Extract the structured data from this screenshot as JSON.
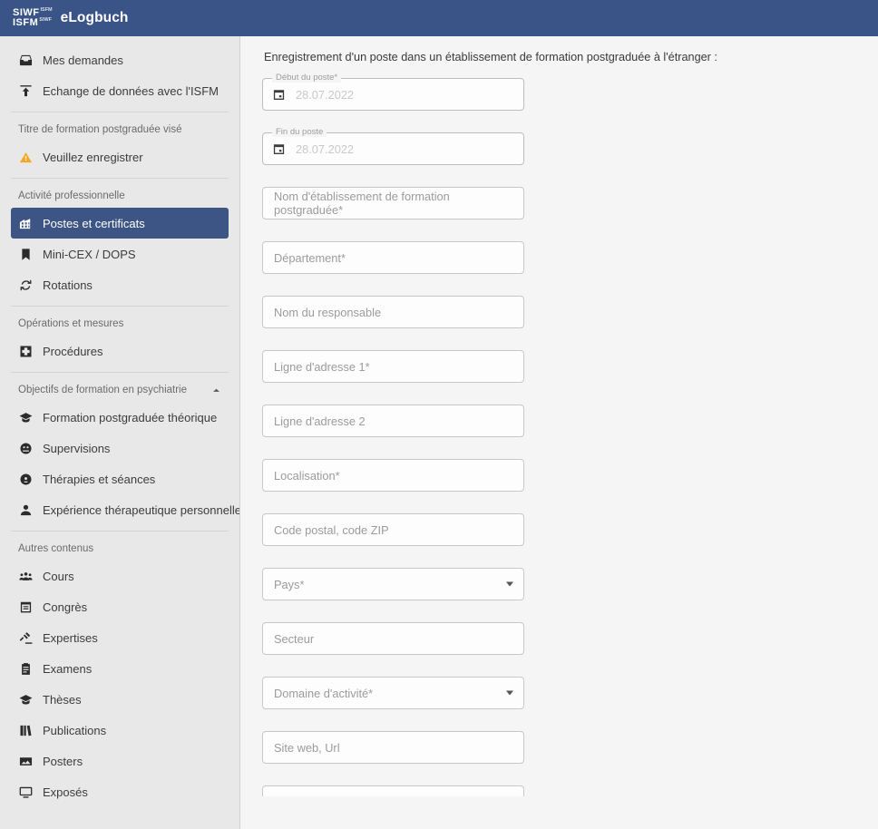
{
  "header": {
    "logo_line1": "SIWF",
    "logo_line1_sup": "ISFM",
    "logo_line2": "ISFM",
    "logo_line2_sup": "SIWF",
    "title": "eLogbuch"
  },
  "sidebar": {
    "groups": [
      {
        "label": null,
        "items": [
          {
            "label": "Mes demandes",
            "icon": "inbox-icon",
            "active": false
          },
          {
            "label": "Echange de données avec l'ISFM",
            "icon": "upload-icon",
            "active": false
          }
        ]
      },
      {
        "label": "Titre de formation postgraduée visé",
        "collapsible": false,
        "items": [
          {
            "label": "Veuillez enregistrer",
            "icon": "warning-triangle-icon",
            "active": false
          }
        ]
      },
      {
        "label": "Activité professionnelle",
        "collapsible": false,
        "items": [
          {
            "label": "Postes et certificats",
            "icon": "building-icon",
            "active": true
          },
          {
            "label": "Mini-CEX / DOPS",
            "icon": "book-icon",
            "active": false
          },
          {
            "label": "Rotations",
            "icon": "rotate-icon",
            "active": false
          }
        ]
      },
      {
        "label": "Opérations et mesures",
        "collapsible": false,
        "items": [
          {
            "label": "Procédures",
            "icon": "medical-cross-icon",
            "active": false
          }
        ]
      },
      {
        "label": "Objectifs de formation en psychiatrie",
        "collapsible": true,
        "items": [
          {
            "label": "Formation postgraduée théorique",
            "icon": "graduation-cap-icon",
            "active": false
          },
          {
            "label": "Supervisions",
            "icon": "supervision-icon",
            "active": false
          },
          {
            "label": "Thérapies et séances",
            "icon": "therapy-head-icon",
            "active": false
          },
          {
            "label": "Expérience thérapeutique personnelle",
            "icon": "person-icon",
            "active": false
          }
        ]
      },
      {
        "label": "Autres contenus",
        "collapsible": false,
        "items": [
          {
            "label": "Cours",
            "icon": "group-people-icon",
            "active": false
          },
          {
            "label": "Congrès",
            "icon": "calendar-board-icon",
            "active": false
          },
          {
            "label": "Expertises",
            "icon": "gavel-icon",
            "active": false
          },
          {
            "label": "Examens",
            "icon": "clipboard-icon",
            "active": false
          },
          {
            "label": "Thèses",
            "icon": "graduation-cap-icon",
            "active": false
          },
          {
            "label": "Publications",
            "icon": "book-open-icon",
            "active": false
          },
          {
            "label": "Posters",
            "icon": "image-icon",
            "active": false
          },
          {
            "label": "Exposés",
            "icon": "monitor-icon",
            "active": false
          }
        ]
      }
    ]
  },
  "main": {
    "intro": "Enregistrement d'un poste dans un établissement de formation postgraduée à l'étranger :",
    "fields": [
      {
        "kind": "date",
        "legend": "Début du poste*",
        "value": "28.07.2022"
      },
      {
        "kind": "date",
        "legend": "Fin du poste",
        "value": "28.07.2022"
      },
      {
        "kind": "text",
        "placeholder": "Nom d'établissement de formation postgraduée*"
      },
      {
        "kind": "text",
        "placeholder": "Département*"
      },
      {
        "kind": "text",
        "placeholder": "Nom du responsable"
      },
      {
        "kind": "text",
        "placeholder": "Ligne d'adresse 1*"
      },
      {
        "kind": "text",
        "placeholder": "Ligne d'adresse 2"
      },
      {
        "kind": "text",
        "placeholder": "Localisation*"
      },
      {
        "kind": "text",
        "placeholder": "Code postal, code ZIP"
      },
      {
        "kind": "select",
        "placeholder": "Pays*"
      },
      {
        "kind": "text",
        "placeholder": "Secteur"
      },
      {
        "kind": "select",
        "placeholder": "Domaine d'activité*"
      },
      {
        "kind": "text",
        "placeholder": "Site web, Url"
      },
      {
        "kind": "partial",
        "placeholder": ""
      }
    ]
  },
  "colors": {
    "brand_navy": "#3a5488",
    "active_nav": "#3d5585",
    "sidebar_bg": "#e8e8e8",
    "main_bg": "#f5f5f5",
    "warning_orange": "#f5a623"
  }
}
